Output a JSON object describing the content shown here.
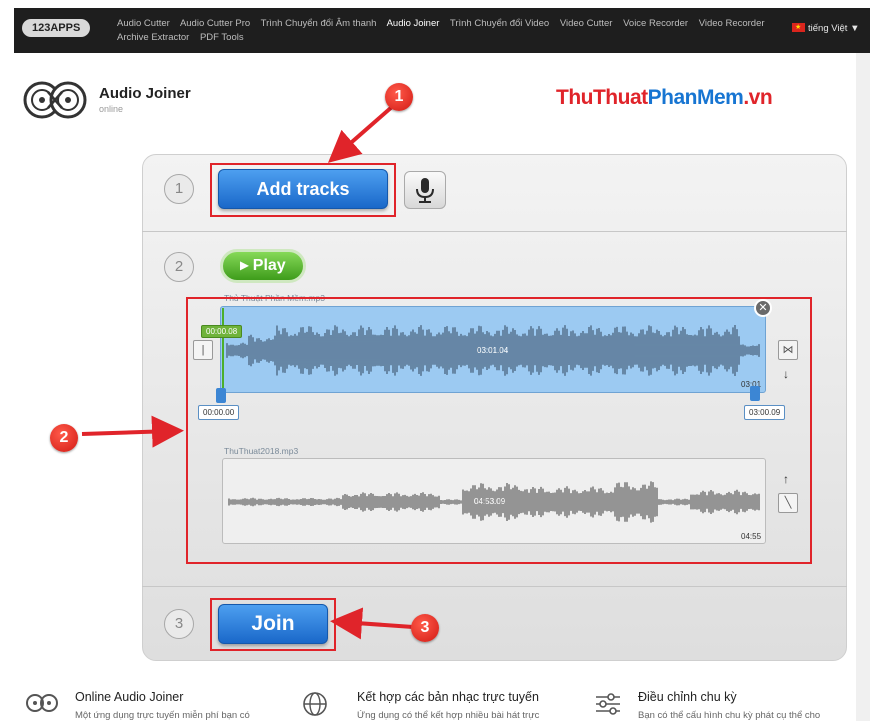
{
  "nav": {
    "brand": "123APPS",
    "links": [
      "Audio Cutter",
      "Audio Cutter Pro",
      "Trình Chuyển đổi Âm thanh",
      "Audio Joiner",
      "Trình Chuyển đổi Video",
      "Video Cutter",
      "Voice Recorder",
      "Video Recorder",
      "Archive Extractor",
      "PDF Tools"
    ],
    "active": "Audio Joiner",
    "language": "tiếng Việt"
  },
  "header": {
    "title": "Audio Joiner",
    "subtitle": "online",
    "watermark_part1": "ThuThuat",
    "watermark_part2": "PhanMem",
    "watermark_part3": ".vn"
  },
  "steps": {
    "step1": "1",
    "step2": "2",
    "step3": "3",
    "add_tracks_label": "Add tracks",
    "play_label": "▸ Play",
    "join_label": "Join"
  },
  "tracks": [
    {
      "name": "Thủ Thuật Phần Mềm.mp3",
      "center_time": "03:01.04",
      "end_time": "03:01",
      "playhead": "00:00.08",
      "start_chip": "00:00.00",
      "end_chip": "03:00.09"
    },
    {
      "name": "ThuThuat2018.mp3",
      "center_time": "04:53.09",
      "end_time": "04:55"
    }
  ],
  "callouts": [
    "1",
    "2",
    "3"
  ],
  "features": [
    {
      "title": "Online Audio Joiner",
      "desc": "Một ứng dụng trực tuyến miễn phí bạn có"
    },
    {
      "title": "Kết hợp các bản nhạc trực tuyến",
      "desc": "Ứng dụng có thể kết hợp nhiều bài hát trực"
    },
    {
      "title": "Điều chỉnh chu kỳ",
      "desc": "Bạn có thể cấu hình chu kỳ phát cụ thể cho"
    }
  ],
  "colors": {
    "accent_blue": "#1a68c9",
    "play_green": "#3e9c1b",
    "annotation_red": "#e0242a",
    "track_blue": "#9ccaf2"
  }
}
